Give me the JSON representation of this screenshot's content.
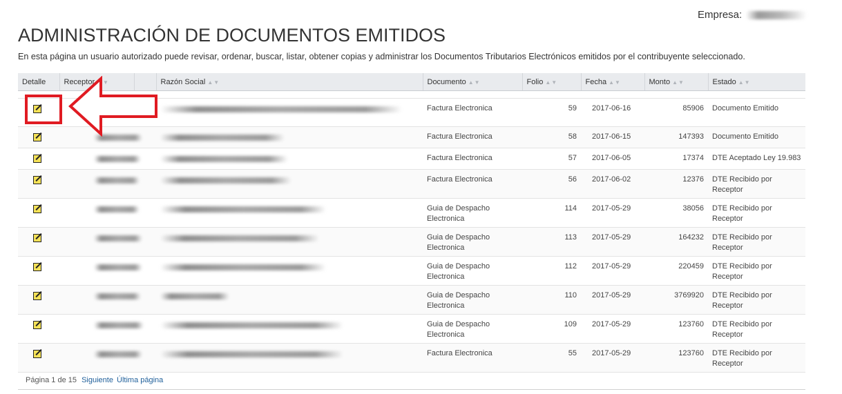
{
  "header": {
    "empresa_label": "Empresa:",
    "title": "ADMINISTRACIÓN DE DOCUMENTOS EMITIDOS",
    "description": "En esta página un usuario autorizado puede revisar, ordenar, buscar, listar, obtener copias y administrar los Documentos Tributarios Electrónicos emitidos por el contribuyente seleccionado."
  },
  "table": {
    "columns": [
      "Detalle",
      "Receptor",
      "Razón Social",
      "Documento",
      "Folio",
      "Fecha",
      "Monto",
      "Estado"
    ],
    "rows": [
      {
        "documento": "Factura Electronica",
        "folio": "59",
        "fecha": "2017-06-16",
        "monto": "85906",
        "estado": "Documento Emitido"
      },
      {
        "documento": "Factura Electronica",
        "folio": "58",
        "fecha": "2017-06-15",
        "monto": "147393",
        "estado": "Documento Emitido"
      },
      {
        "documento": "Factura Electronica",
        "folio": "57",
        "fecha": "2017-06-05",
        "monto": "17374",
        "estado": "DTE Aceptado Ley 19.983"
      },
      {
        "documento": "Factura Electronica",
        "folio": "56",
        "fecha": "2017-06-02",
        "monto": "12376",
        "estado": "DTE Recibido por Receptor"
      },
      {
        "documento": "Guia de Despacho Electronica",
        "folio": "114",
        "fecha": "2017-05-29",
        "monto": "38056",
        "estado": "DTE Recibido por Receptor"
      },
      {
        "documento": "Guia de Despacho Electronica",
        "folio": "113",
        "fecha": "2017-05-29",
        "monto": "164232",
        "estado": "DTE Recibido por Receptor"
      },
      {
        "documento": "Guia de Despacho Electronica",
        "folio": "112",
        "fecha": "2017-05-29",
        "monto": "220459",
        "estado": "DTE Recibido por Receptor"
      },
      {
        "documento": "Guia de Despacho Electronica",
        "folio": "110",
        "fecha": "2017-05-29",
        "monto": "3769920",
        "estado": "DTE Recibido por Receptor"
      },
      {
        "documento": "Guia de Despacho Electronica",
        "folio": "109",
        "fecha": "2017-05-29",
        "monto": "123760",
        "estado": "DTE Recibido por Receptor"
      },
      {
        "documento": "Factura Electronica",
        "folio": "55",
        "fecha": "2017-05-29",
        "monto": "123760",
        "estado": "DTE Recibido por Receptor"
      }
    ],
    "row_icon": "edit-icon"
  },
  "pager": {
    "page_text": "Página 1 de 15",
    "next_label": "Siguiente",
    "last_label": "Última página"
  },
  "colors": {
    "header_bg": "#e9ebee",
    "highlight": "#e01b22",
    "link": "#1f5f9a"
  }
}
